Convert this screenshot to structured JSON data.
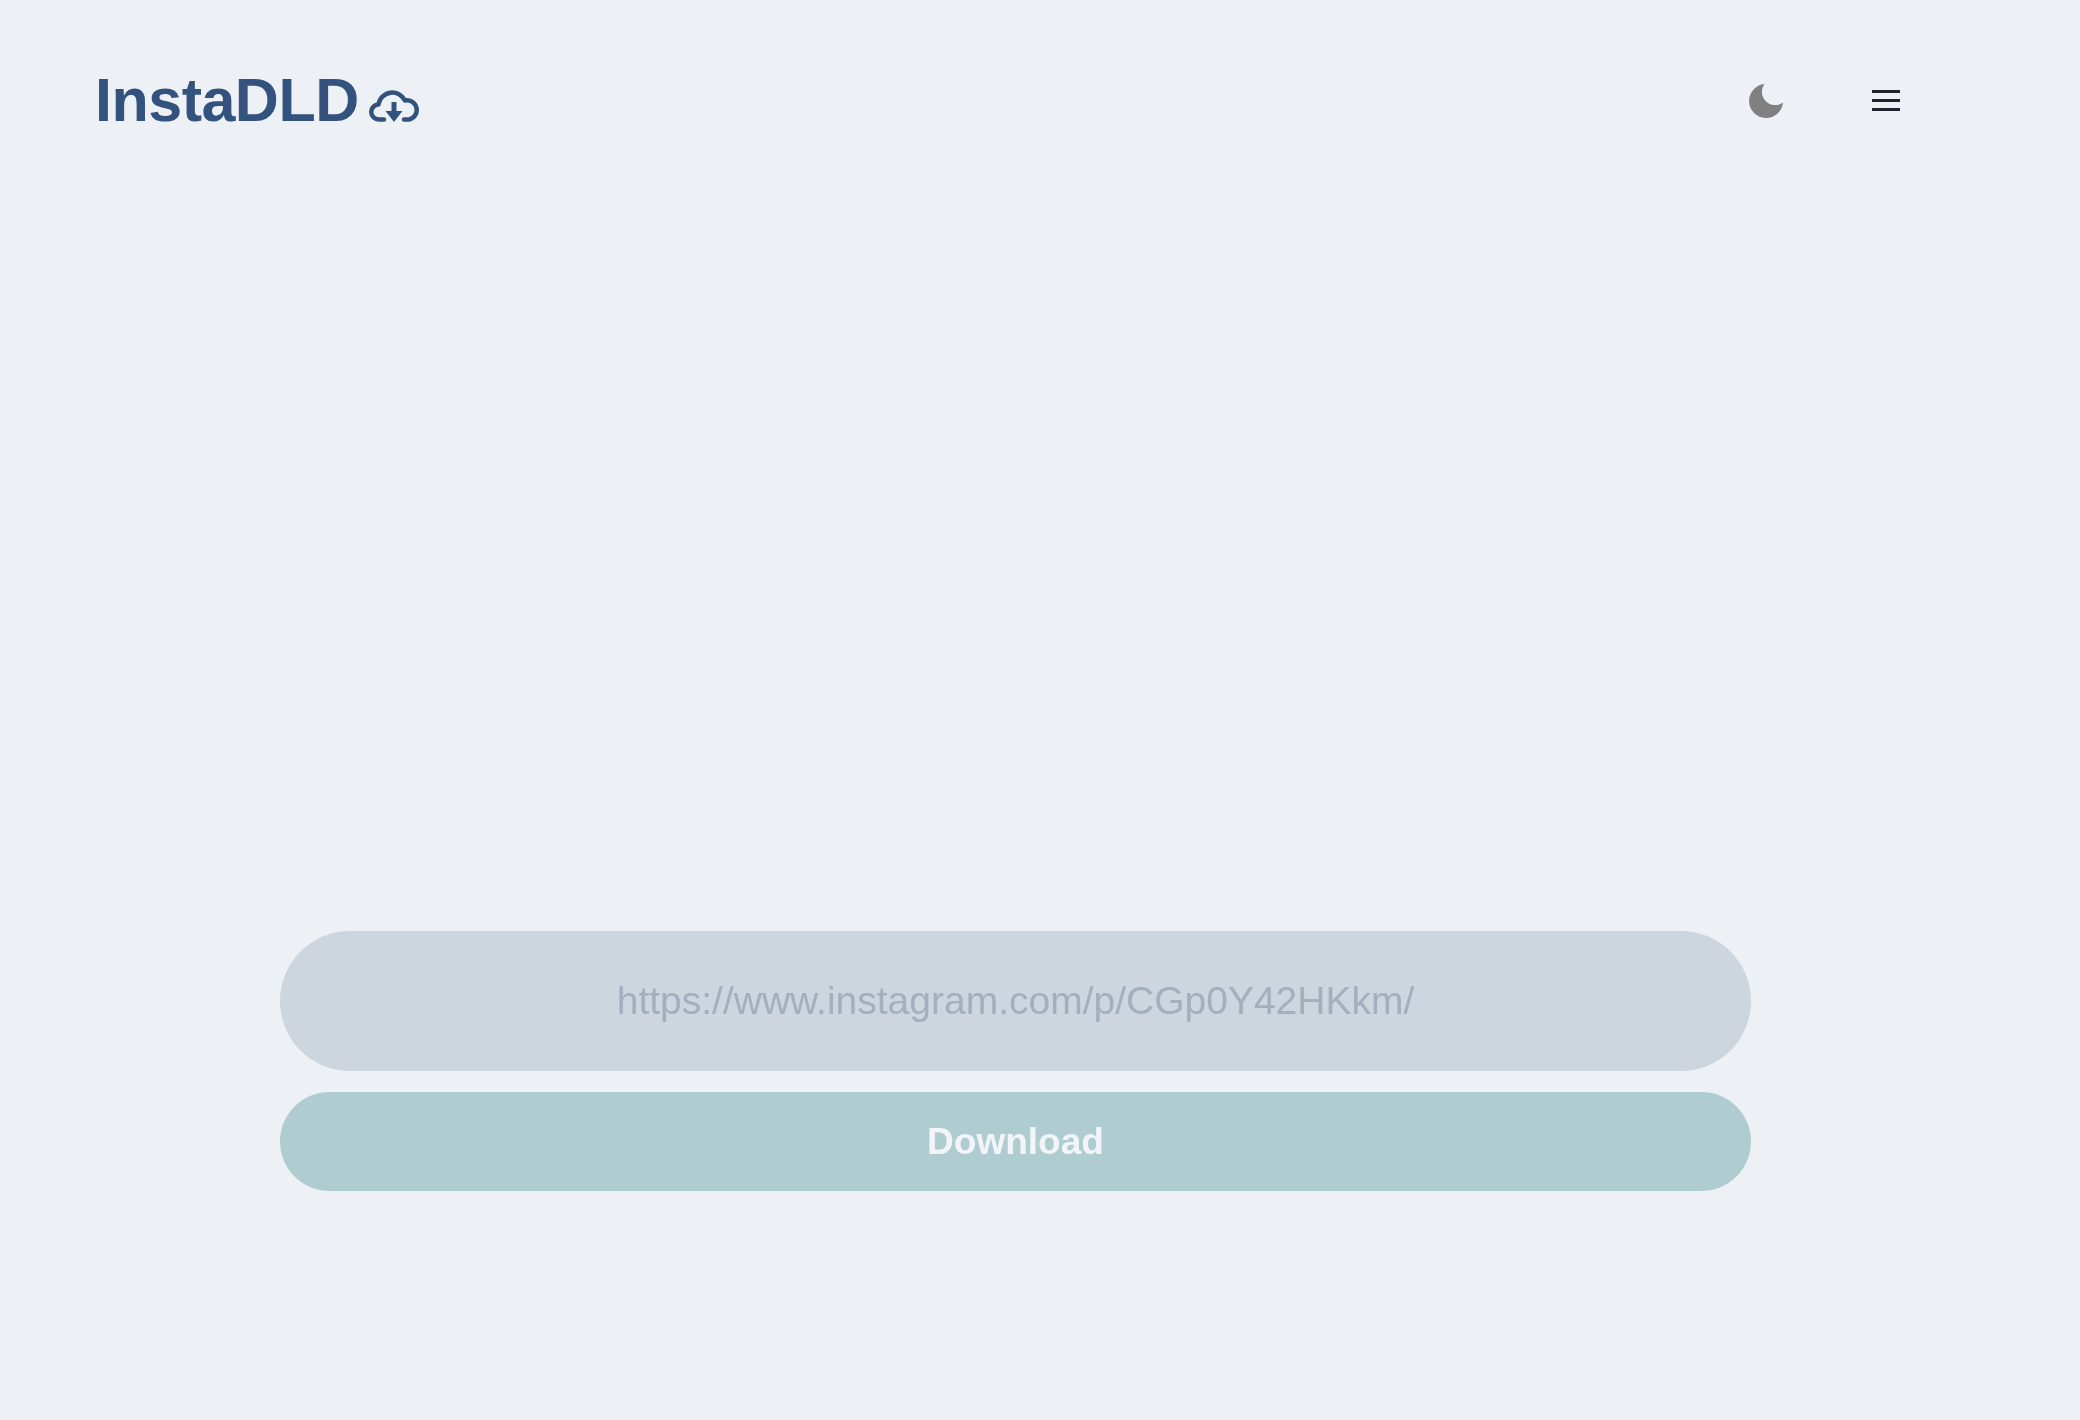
{
  "header": {
    "logo": "InstaDLD"
  },
  "url_input": {
    "placeholder": "https://www.instagram.com/p/CGp0Y42HKkm/"
  },
  "download_button": {
    "label": "Download"
  }
}
